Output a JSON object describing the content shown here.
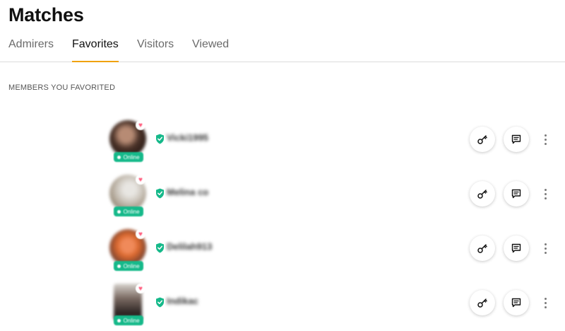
{
  "header": {
    "title": "Matches"
  },
  "tabs": [
    {
      "label": "Admirers",
      "active": false
    },
    {
      "label": "Favorites",
      "active": true
    },
    {
      "label": "Visitors",
      "active": false
    },
    {
      "label": "Viewed",
      "active": false
    }
  ],
  "section": {
    "label": "MEMBERS YOU FAVORITED"
  },
  "members": [
    {
      "username": "Vicki1995",
      "status": "Online",
      "favorited": true,
      "verified": true
    },
    {
      "username": "Melina co",
      "status": "Online",
      "favorited": true,
      "verified": true
    },
    {
      "username": "Delilah913",
      "status": "Online",
      "favorited": true,
      "verified": true
    },
    {
      "username": "Indikac",
      "status": "Online",
      "favorited": true,
      "verified": true
    }
  ],
  "icons": {
    "favorite": "heart-icon",
    "verified": "shield-check-icon",
    "unlock": "key-icon",
    "message": "message-icon",
    "more": "more-vertical-icon"
  },
  "colors": {
    "accent": "#f0a20a",
    "online": "#16b98a",
    "verified": "#16b98a",
    "heart": "#ff5a7a"
  }
}
